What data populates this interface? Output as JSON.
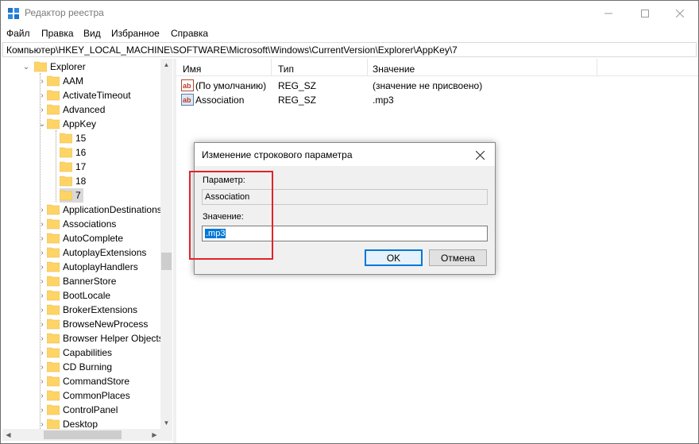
{
  "window": {
    "title": "Редактор реестра",
    "controls": {
      "minimize": "—",
      "maximize": "☐",
      "close": "✕"
    }
  },
  "menu": [
    "Файл",
    "Правка",
    "Вид",
    "Избранное",
    "Справка"
  ],
  "address": "Компьютер\\HKEY_LOCAL_MACHINE\\SOFTWARE\\Microsoft\\Windows\\CurrentVersion\\Explorer\\AppKey\\7",
  "tree": {
    "explorer": "Explorer",
    "items": [
      {
        "label": "AAM",
        "state": "collapsed"
      },
      {
        "label": "ActivateTimeout",
        "state": "collapsed"
      },
      {
        "label": "Advanced",
        "state": "collapsed"
      },
      {
        "label": "AppKey",
        "state": "expanded"
      },
      {
        "label": "15",
        "state": "leaf"
      },
      {
        "label": "16",
        "state": "leaf"
      },
      {
        "label": "17",
        "state": "leaf"
      },
      {
        "label": "18",
        "state": "leaf"
      },
      {
        "label": "7",
        "state": "selected"
      },
      {
        "label": "ApplicationDestinations",
        "state": "collapsed"
      },
      {
        "label": "Associations",
        "state": "collapsed"
      },
      {
        "label": "AutoComplete",
        "state": "collapsed"
      },
      {
        "label": "AutoplayExtensions",
        "state": "collapsed"
      },
      {
        "label": "AutoplayHandlers",
        "state": "collapsed"
      },
      {
        "label": "BannerStore",
        "state": "collapsed"
      },
      {
        "label": "BootLocale",
        "state": "collapsed"
      },
      {
        "label": "BrokerExtensions",
        "state": "collapsed"
      },
      {
        "label": "BrowseNewProcess",
        "state": "collapsed"
      },
      {
        "label": "Browser Helper Objects",
        "state": "collapsed"
      },
      {
        "label": "Capabilities",
        "state": "collapsed"
      },
      {
        "label": "CD Burning",
        "state": "collapsed"
      },
      {
        "label": "CommandStore",
        "state": "collapsed"
      },
      {
        "label": "CommonPlaces",
        "state": "collapsed"
      },
      {
        "label": "ControlPanel",
        "state": "collapsed"
      },
      {
        "label": "Desktop",
        "state": "collapsed"
      }
    ]
  },
  "list": {
    "columns": [
      "Имя",
      "Тип",
      "Значение"
    ],
    "rows": [
      {
        "name": "(По умолчанию)",
        "type": "REG_SZ",
        "value": "(значение не присвоено)"
      },
      {
        "name": "Association",
        "type": "REG_SZ",
        "value": ".mp3"
      }
    ]
  },
  "dialog": {
    "title": "Изменение строкового параметра",
    "param_label": "Параметр:",
    "param_value": "Association",
    "value_label": "Значение:",
    "value_value": ".mp3",
    "ok": "OK",
    "cancel": "Отмена"
  },
  "colors": {
    "folder": "#ffd466",
    "selection": "#0078d7",
    "highlight_box": "#e0242a"
  }
}
